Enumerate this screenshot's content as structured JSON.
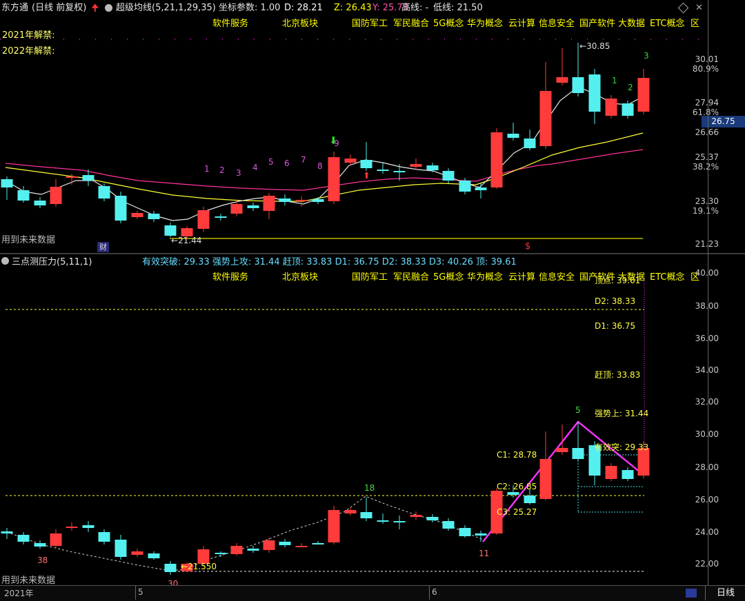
{
  "header": {
    "app": "东方通",
    "mode": "(日线 前复权)",
    "indicator": "超级均线(5,21,1,29,35)",
    "coord_param": "坐标参数: 1.00",
    "D": "D: 28.21",
    "Z": "Z: 26.43",
    "Y": "Y: 25.73",
    "high": "高线: -",
    "low": "低线: 21.50"
  },
  "sectors": [
    "软件服务",
    "北京板块",
    "国防军工",
    "军民融合",
    "5G概念",
    "华为概念",
    "云计算",
    "信息安全",
    "国产软件",
    "大数据",
    "ETC概念",
    "区"
  ],
  "unlock": [
    "2021年解禁:",
    "2022年解禁:"
  ],
  "top_axis": {
    "ticks": [
      "30.01",
      "27.94",
      "26.66",
      "25.37",
      "23.30",
      "21.23"
    ],
    "pcts": [
      "80.9%",
      "61.8%",
      "38.2%",
      "19.1%"
    ],
    "current": "26.75"
  },
  "top_labels": {
    "high": "30.85",
    "low": "21.44",
    "future_note": "用到未来数据",
    "cai": "财",
    "dollar": "$"
  },
  "seq_numbers": [
    "1",
    "2",
    "3",
    "4",
    "5",
    "6",
    "7",
    "8",
    "9",
    "1",
    "2",
    "3"
  ],
  "lower_panel": {
    "title": "三点测压力(5,11,1)",
    "params": "有效突破: 29.33  强势上攻: 31.44  赶顶: 33.83  D1: 36.75  D2: 38.33  D3: 40.26  顶: 39.61",
    "ticks": [
      "40.00",
      "38.00",
      "36.00",
      "34.00",
      "32.00",
      "30.00",
      "28.00",
      "26.00",
      "24.00",
      "22.00"
    ],
    "right_labels": {
      "top": "顶点: 39.61",
      "d2": "D2: 38.33",
      "d1": "D1: 36.75",
      "ganding": "赶顶: 33.83",
      "qiangshi": "强势上: 31.44",
      "youxiao": "有效突: 29.33"
    },
    "c_labels": {
      "c1": "C1: 28.78",
      "c2": "C2: 26.85",
      "c3": "C3: 25.27"
    },
    "pivots": {
      "p38": "38",
      "p30": "30",
      "p18": "18",
      "p11": "11",
      "p5": "5",
      "low_val": "21.550"
    },
    "future_note": "用到未来数据"
  },
  "bottom": {
    "year": "2021年",
    "m5": "5",
    "m6": "6",
    "period_button": "日线"
  },
  "colors": {
    "up": "#ff3b3b",
    "down": "#54f0f0",
    "yellow": "#ffff00",
    "magenta": "#ff33ff",
    "bg": "#000000"
  }
}
